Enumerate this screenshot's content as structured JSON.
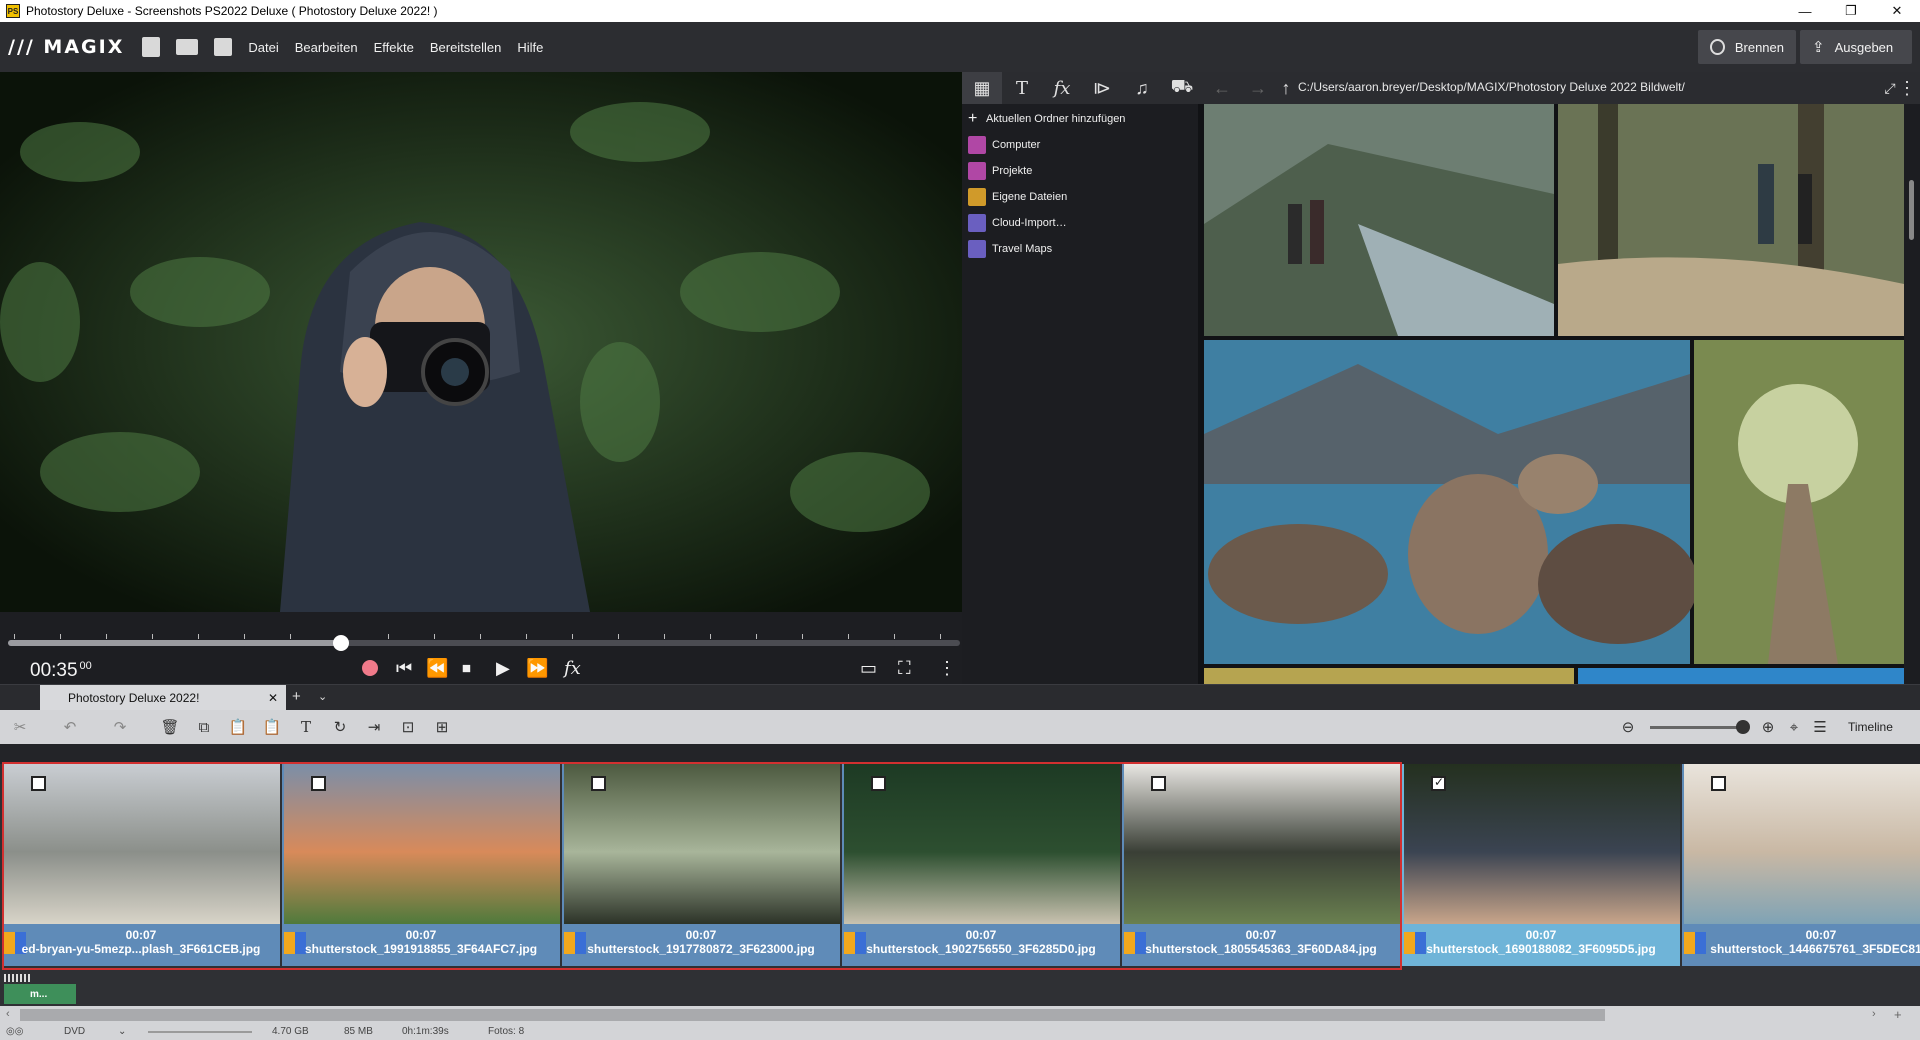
{
  "window": {
    "title": "Photostory Deluxe - Screenshots PS2022 Deluxe ( Photostory Deluxe 2022! )",
    "controls": [
      "—",
      "❐",
      "✕"
    ]
  },
  "menubar": {
    "logo": "/// MAGIX",
    "menus": [
      "Datei",
      "Bearbeiten",
      "Effekte",
      "Bereitstellen",
      "Hilfe"
    ],
    "burn_label": "Brennen",
    "export_label": "Ausgeben"
  },
  "preview": {
    "timecode": "00:35",
    "frames": "00",
    "position": 0.35
  },
  "media_pool": {
    "path": "C:/Users/aaron.breyer/Desktop/MAGIX/Photostory Deluxe 2022 Bildwelt/",
    "add_folder": "Aktuellen Ordner hinzufügen",
    "tree": [
      {
        "label": "Computer",
        "color": "#b047a5"
      },
      {
        "label": "Projekte",
        "color": "#b047a5"
      },
      {
        "label": "Eigene Dateien",
        "color": "#d09a2a"
      },
      {
        "label": "Cloud-Import…",
        "color": "#6a5fc0"
      },
      {
        "label": "Travel Maps",
        "color": "#6a5fc0"
      }
    ]
  },
  "storyboard": {
    "project_tab": "Photostory Deluxe 2022!",
    "view_label": "Timeline",
    "clips": [
      {
        "duration": "00:07",
        "file": "ed-bryan-yu-5mezp...plash_3F661CEB.jpg",
        "checked": false
      },
      {
        "duration": "00:07",
        "file": "shutterstock_1991918855_3F64AFC7.jpg",
        "checked": false
      },
      {
        "duration": "00:07",
        "file": "shutterstock_1917780872_3F623000.jpg",
        "checked": false
      },
      {
        "duration": "00:07",
        "file": "shutterstock_1902756550_3F6285D0.jpg",
        "checked": false
      },
      {
        "duration": "00:07",
        "file": "shutterstock_1805545363_3F60DA84.jpg",
        "checked": false
      },
      {
        "duration": "00:07",
        "file": "shutterstock_1690188082_3F6095D5.jpg",
        "checked": true
      },
      {
        "duration": "00:07",
        "file": "shutterstock_1446675761_3F5DEC81...",
        "checked": false
      }
    ],
    "audio_clip": "m..."
  },
  "status": {
    "format": "DVD",
    "size": "4.70 GB",
    "used": "85 MB",
    "duration": "0h:1m:39s",
    "photos": "Fotos: 8"
  }
}
